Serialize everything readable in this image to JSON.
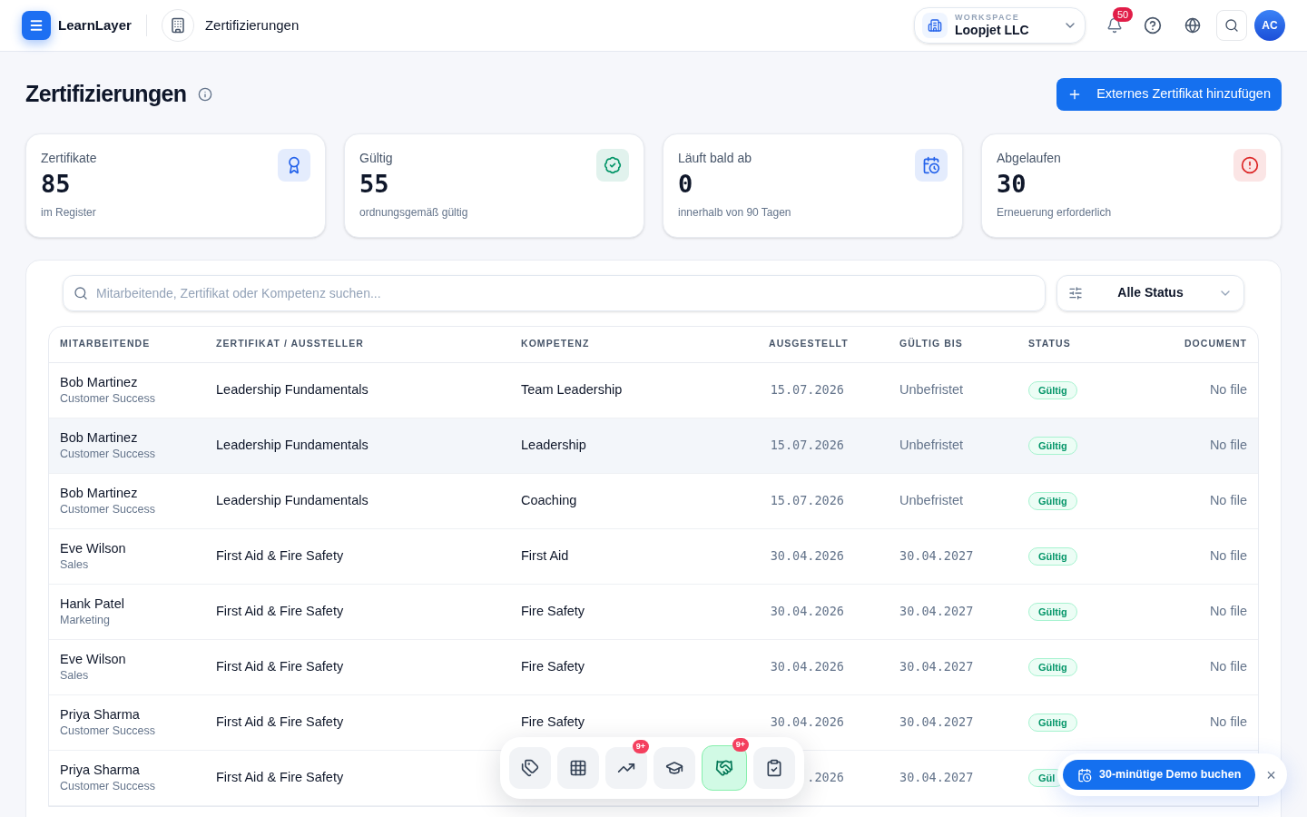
{
  "header": {
    "brand": "LearnLayer",
    "section": "Zertifizierungen",
    "workspace": {
      "label": "WORKSPACE",
      "name": "Loopjet LLC"
    },
    "notifications": "50",
    "avatar": "AC"
  },
  "page": {
    "title": "Zertifizierungen",
    "add_button": "Externes Zertifikat hinzufügen"
  },
  "stats": [
    {
      "label": "Zertifikate",
      "value": "85",
      "caption": "im Register",
      "color": "#2563eb"
    },
    {
      "label": "Gültig",
      "value": "55",
      "caption": "ordnungsgemäß gültig",
      "color": "#059669"
    },
    {
      "label": "Läuft bald ab",
      "value": "0",
      "caption": "innerhalb von 90 Tagen",
      "color": "#2563eb"
    },
    {
      "label": "Abgelaufen",
      "value": "30",
      "caption": "Erneuerung erforderlich",
      "color": "#dc2626"
    }
  ],
  "search": {
    "placeholder": "Mitarbeitende, Zertifikat oder Kompetenz suchen..."
  },
  "status_filter": "Alle Status",
  "table": {
    "columns": [
      "MITARBEITENDE",
      "ZERTIFIKAT / AUSSTELLER",
      "KOMPETENZ",
      "AUSGESTELLT",
      "GÜLTIG BIS",
      "STATUS",
      "DOCUMENT"
    ],
    "rows": [
      {
        "name": "Bob Martinez",
        "team": "Customer Success",
        "certificate": "Leadership Fundamentals",
        "competence": "Team Leadership",
        "issued": "15.07.2026",
        "valid_until": "Unbefristet",
        "status": "Gültig",
        "document": "No file",
        "selected": false
      },
      {
        "name": "Bob Martinez",
        "team": "Customer Success",
        "certificate": "Leadership Fundamentals",
        "competence": "Leadership",
        "issued": "15.07.2026",
        "valid_until": "Unbefristet",
        "status": "Gültig",
        "document": "No file",
        "selected": true
      },
      {
        "name": "Bob Martinez",
        "team": "Customer Success",
        "certificate": "Leadership Fundamentals",
        "competence": "Coaching",
        "issued": "15.07.2026",
        "valid_until": "Unbefristet",
        "status": "Gültig",
        "document": "No file",
        "selected": false
      },
      {
        "name": "Eve Wilson",
        "team": "Sales",
        "certificate": "First Aid & Fire Safety",
        "competence": "First Aid",
        "issued": "30.04.2026",
        "valid_until": "30.04.2027",
        "status": "Gültig",
        "document": "No file",
        "selected": false
      },
      {
        "name": "Hank Patel",
        "team": "Marketing",
        "certificate": "First Aid & Fire Safety",
        "competence": "Fire Safety",
        "issued": "30.04.2026",
        "valid_until": "30.04.2027",
        "status": "Gültig",
        "document": "No file",
        "selected": false
      },
      {
        "name": "Eve Wilson",
        "team": "Sales",
        "certificate": "First Aid & Fire Safety",
        "competence": "Fire Safety",
        "issued": "30.04.2026",
        "valid_until": "30.04.2027",
        "status": "Gültig",
        "document": "No file",
        "selected": false
      },
      {
        "name": "Priya Sharma",
        "team": "Customer Success",
        "certificate": "First Aid & Fire Safety",
        "competence": "Fire Safety",
        "issued": "30.04.2026",
        "valid_until": "30.04.2027",
        "status": "Gültig",
        "document": "No file",
        "selected": false
      },
      {
        "name": "Priya Sharma",
        "team": "Customer Success",
        "certificate": "First Aid & Fire Safety",
        "issued": ".2026",
        "valid_until": "30.04.2027",
        "status": "Gül",
        "selected": false
      }
    ]
  },
  "dock": [
    {
      "selected": false
    },
    {
      "selected": false
    },
    {
      "selected": false,
      "badge": "9+"
    },
    {
      "selected": false
    },
    {
      "selected": true,
      "badge": "9+"
    },
    {
      "selected": false
    }
  ],
  "demo_popup": {
    "button": "30-minütige Demo buchen",
    "close": "×"
  }
}
